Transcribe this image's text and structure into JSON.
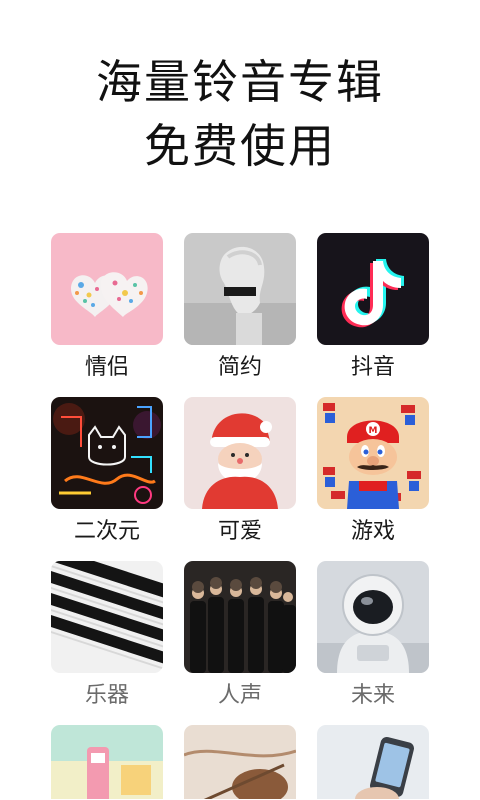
{
  "header": {
    "line1": "海量铃音专辑",
    "line2": "免费使用"
  },
  "albums": [
    {
      "label": "情侣"
    },
    {
      "label": "简约"
    },
    {
      "label": "抖音"
    },
    {
      "label": "二次元"
    },
    {
      "label": "可爱"
    },
    {
      "label": "游戏"
    },
    {
      "label": "乐器"
    },
    {
      "label": "人声"
    },
    {
      "label": "未来"
    }
  ]
}
